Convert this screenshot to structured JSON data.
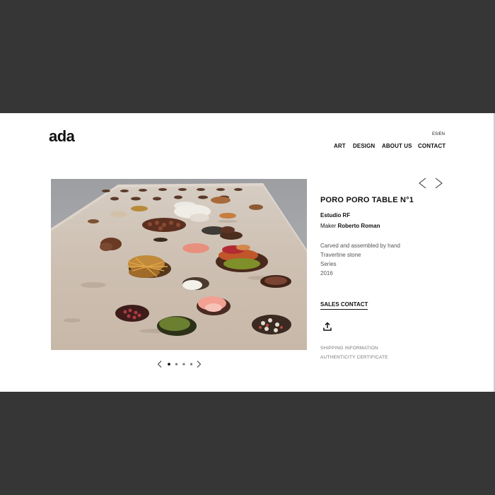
{
  "brand": {
    "logo": "ada"
  },
  "header": {
    "lang_switch": "ES/EN",
    "nav": [
      {
        "label": "ART"
      },
      {
        "label": "DESIGN"
      },
      {
        "label": "ABOUT US"
      },
      {
        "label": "CONTACT"
      }
    ]
  },
  "product": {
    "title": "PORO PORO TABLE N°1",
    "studio": "Estudio RF",
    "maker_prefix": "Maker",
    "maker_name": "Roberto Roman",
    "details": [
      "Carved and assembled by hand",
      "Travertine stone",
      "Series",
      "2016"
    ],
    "sales_contact": "SALES CONTACT",
    "links": [
      "SHIPPING INFORMATION",
      "AUTHENTICITY CERTIFICATE"
    ]
  },
  "gallery": {
    "slide_count": 4,
    "active_slide": 1
  },
  "icons": {
    "prev": "chevron-left-icon",
    "next": "chevron-right-icon",
    "share": "share-icon"
  },
  "colors": {
    "backdrop": "#363636",
    "page": "#ffffff",
    "text": "#111111",
    "muted": "#555555"
  }
}
